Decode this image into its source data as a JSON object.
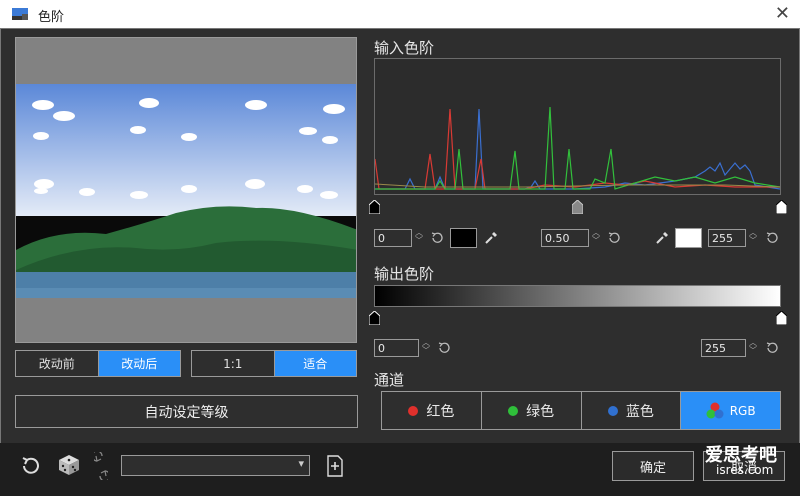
{
  "window": {
    "title": "色阶",
    "close_icon": "close-icon"
  },
  "preview": {
    "mode_before": "改动前",
    "mode_after": "改动后",
    "zoom_1to1": "1:1",
    "zoom_fit": "适合",
    "active_mode": "改动后",
    "active_zoom": "适合"
  },
  "auto_button": "自动设定等级",
  "input_levels": {
    "label": "输入色阶",
    "black_value": "0",
    "gamma_value": "0.50",
    "white_value": "255",
    "black_swatch_color": "#000000",
    "white_swatch_color": "#ffffff"
  },
  "output_levels": {
    "label": "输出色阶",
    "black_value": "0",
    "white_value": "255"
  },
  "channel": {
    "label": "通道",
    "options": [
      {
        "label": "红色",
        "color": "#e0302c"
      },
      {
        "label": "绿色",
        "color": "#2fbf3a"
      },
      {
        "label": "蓝色",
        "color": "#3070d0"
      },
      {
        "label": "RGB",
        "color": "rgb"
      }
    ],
    "active": "RGB"
  },
  "bottom": {
    "ok_label": "确定",
    "cancel_label": "取消",
    "preset_value": ""
  },
  "watermark": {
    "line1": "爱思考吧",
    "line2": "isres.com"
  },
  "colors": {
    "accent": "#2a8ff7",
    "background": "#2e2e2e"
  }
}
